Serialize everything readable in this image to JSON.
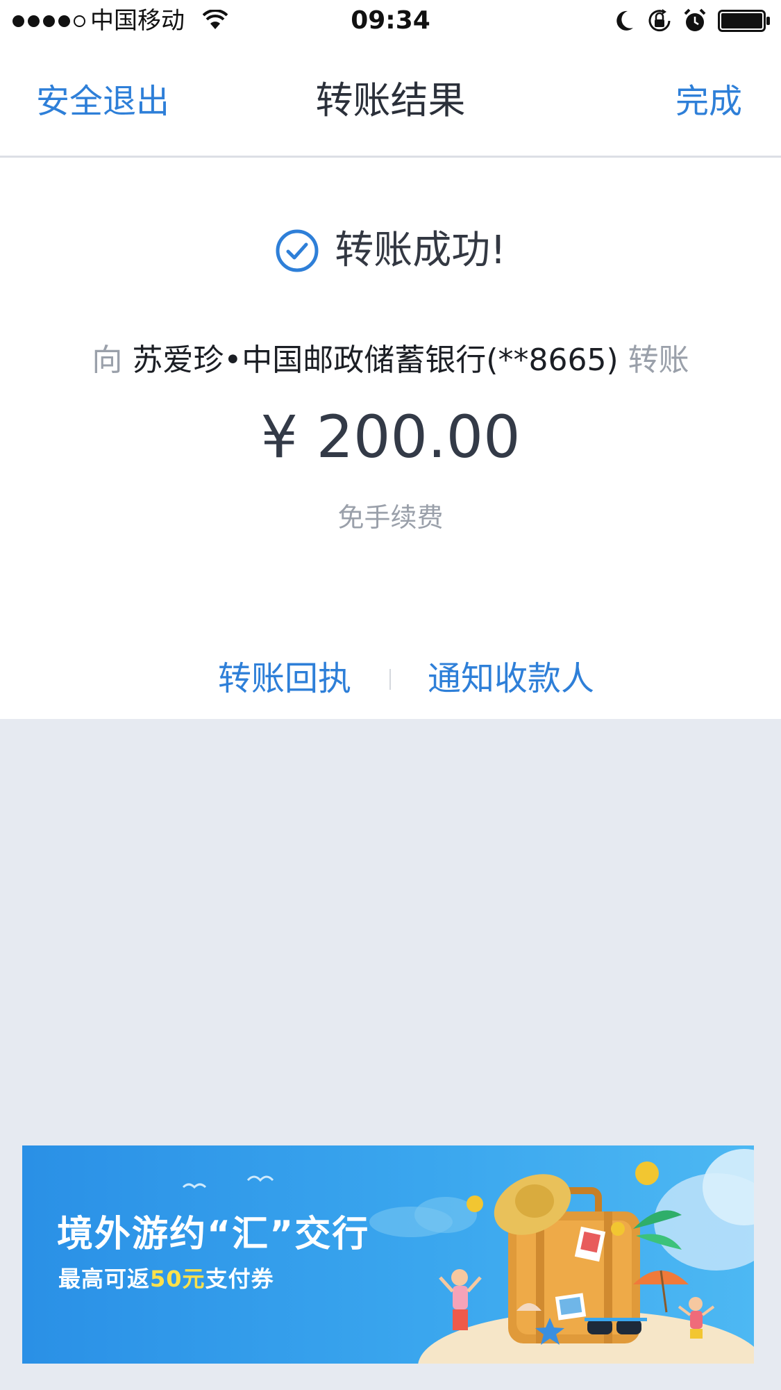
{
  "status_bar": {
    "carrier": "中国移动",
    "time": "09:34"
  },
  "nav": {
    "left_label": "安全退出",
    "title": "转账结果",
    "right_label": "完成"
  },
  "result": {
    "status_text": "转账成功!",
    "recipient_prefix": "向",
    "recipient_name_bank": "苏爱珍•中国邮政储蓄银行(**8665)",
    "recipient_suffix": "转账",
    "amount": "¥ 200.00",
    "fee_note": "免手续费"
  },
  "actions": {
    "receipt_label": "转账回执",
    "notify_label": "通知收款人"
  },
  "banner": {
    "title": "境外游约“汇”交行",
    "subtitle_prefix": "最高可返",
    "subtitle_highlight": "50元",
    "subtitle_suffix": "支付券"
  },
  "colors": {
    "accent": "#2e7fd8",
    "background": "#e6eaf1",
    "muted_text": "#9aa0aa",
    "banner_blue": "#3aa6ee",
    "banner_highlight": "#ffe14a"
  },
  "icons": {
    "status_check": "check-circle-icon",
    "wifi": "wifi-icon",
    "moon": "moon-icon",
    "rotation_lock": "rotation-lock-icon",
    "alarm": "alarm-icon",
    "battery": "battery-icon"
  }
}
